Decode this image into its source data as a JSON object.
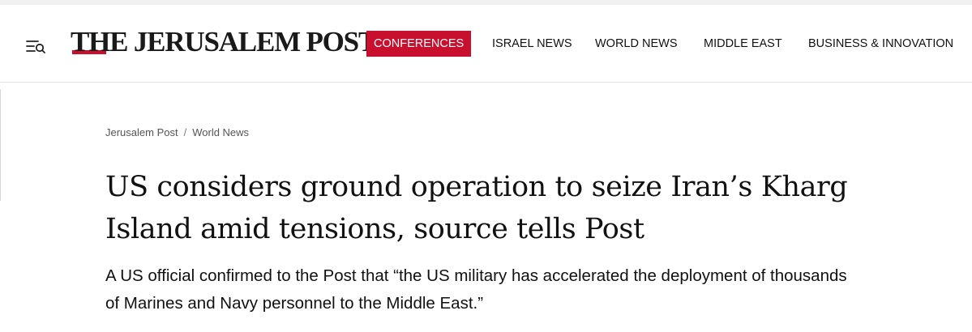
{
  "header": {
    "logo_text": "THE JERUSALEM POST",
    "menu_icon": "menu-search-icon",
    "brand_color": "#c8102e"
  },
  "nav": {
    "items": [
      {
        "label": "CONFERENCES",
        "active": true
      },
      {
        "label": "ISRAEL NEWS",
        "active": false
      },
      {
        "label": "WORLD NEWS",
        "active": false
      },
      {
        "label": "MIDDLE EAST",
        "active": false
      },
      {
        "label": "BUSINESS & INNOVATION",
        "active": false
      }
    ]
  },
  "breadcrumb": {
    "items": [
      "Jerusalem Post",
      "World News"
    ],
    "separator": "/"
  },
  "article": {
    "headline": "US considers ground operation to seize Iran’s Kharg Island amid tensions, source tells Post",
    "subheadline": "A US official confirmed to the Post that “the US military has accelerated the deployment of thousands of Marines and Navy personnel to the Middle East.”"
  }
}
